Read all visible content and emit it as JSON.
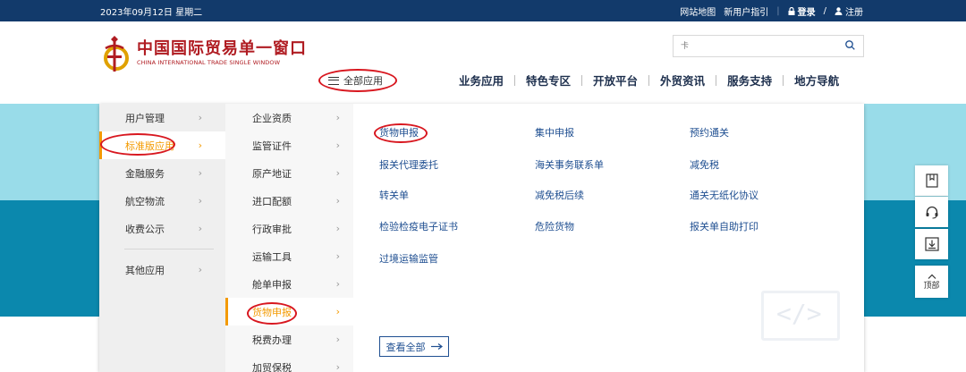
{
  "topbar": {
    "date": "2023年09月12日 星期二",
    "links": {
      "sitemap": "网站地图",
      "guide": "新用户指引",
      "login": "登录",
      "register": "注册"
    },
    "separator": "|",
    "slash": "/"
  },
  "header": {
    "logo_cn": "中国国际贸易单一窗口",
    "logo_en": "CHINA INTERNATIONAL TRADE SINGLE WINDOW",
    "all_apps": "全部应用",
    "search_placeholder": "卡",
    "nav": [
      "业务应用",
      "特色专区",
      "开放平台",
      "外贸资讯",
      "服务支持",
      "地方导航"
    ]
  },
  "menu": {
    "col1": [
      "用户管理",
      "标准版应用",
      "金融服务",
      "航空物流",
      "收费公示",
      "其他应用"
    ],
    "col2": [
      "企业资质",
      "监管证件",
      "原产地证",
      "进口配额",
      "行政审批",
      "运输工具",
      "舱单申报",
      "货物申报",
      "税费办理",
      "加贸保税"
    ],
    "links": [
      [
        "货物申报",
        "集中申报",
        "预约通关"
      ],
      [
        "报关代理委托",
        "海关事务联系单",
        "减免税"
      ],
      [
        "转关单",
        "减免税后续",
        "通关无纸化协议"
      ],
      [
        "检验检疫电子证书",
        "危险货物",
        "报关单自助打印"
      ],
      [
        "过境运输监管"
      ]
    ],
    "view_all": "查看全部",
    "active_col1": 1,
    "active_col2": 7,
    "deco_code": "</>"
  },
  "tools": {
    "top_label": "顶部"
  },
  "colors": {
    "accent": "#f39a00",
    "link": "#1f4f91",
    "topbar": "#123a6b",
    "annotation": "#d8171f"
  },
  "icons": [
    "lock-icon",
    "user-icon",
    "search-icon",
    "hamburger-icon",
    "chevron-right-icon",
    "arrow-right-icon",
    "book-icon",
    "headset-icon",
    "download-icon",
    "arrow-up-icon"
  ]
}
